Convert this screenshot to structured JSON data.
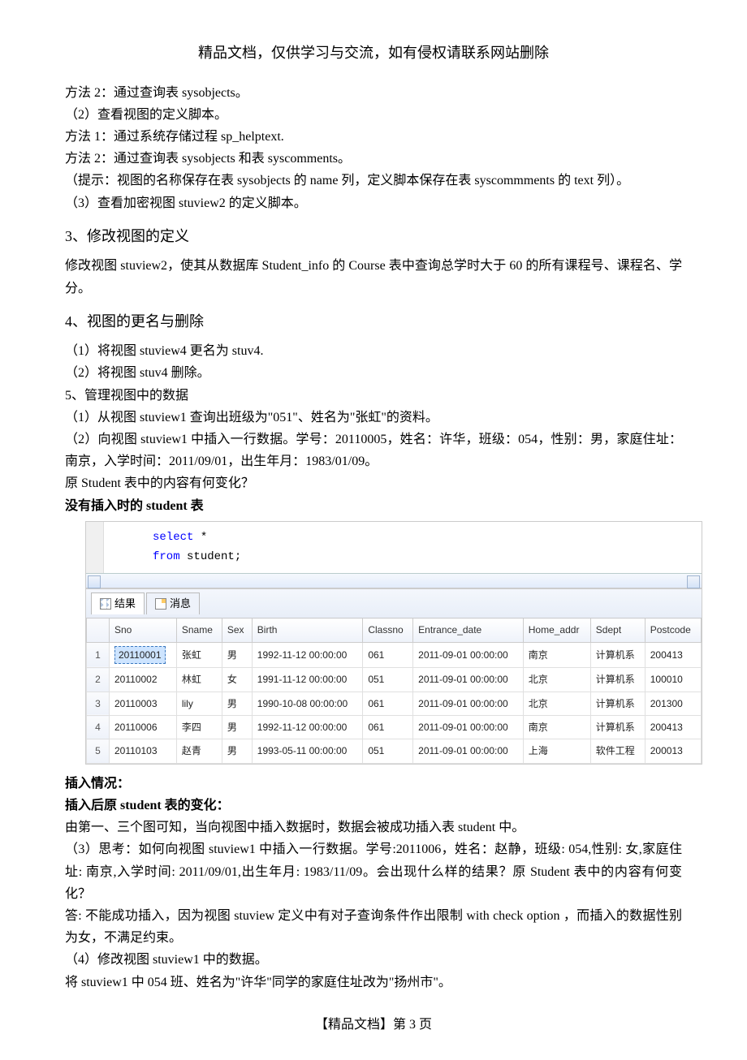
{
  "header": {
    "title": "精品文档，仅供学习与交流，如有侵权请联系网站删除"
  },
  "body": {
    "p1": "方法 2：通过查询表 sysobjects。",
    "p2": "（2）查看视图的定义脚本。",
    "p3": "方法 1：通过系统存储过程 sp_helptext.",
    "p4": "方法 2：通过查询表 sysobjects 和表 syscomments。",
    "p5": "（提示：视图的名称保存在表 sysobjects 的 name 列，定义脚本保存在表 syscommments 的 text 列）。",
    "p6": "（3）查看加密视图 stuview2 的定义脚本。",
    "s3_title": "3、修改视图的定义",
    "p7": "修改视图 stuview2，使其从数据库 Student_info 的 Course 表中查询总学时大于 60 的所有课程号、课程名、学分。",
    "s4_title": "4、视图的更名与删除",
    "p8": "（1）将视图 stuview4 更名为 stuv4.",
    "p9": "（2）将视图 stuv4 删除。",
    "p10": "5、管理视图中的数据",
    "p11": "（1）从视图 stuview1 查询出班级为\"051\"、姓名为\"张虹\"的资料。",
    "p12": "（2）向视图 stuview1 中插入一行数据。学号：20110005，姓名：许华，班级：054，性别：男，家庭住址：南京，入学时间：2011/09/01，出生年月：1983/01/09。",
    "p13": "原 Student 表中的内容有何变化？",
    "p14": "没有插入时的 student 表",
    "p15": "插入情况：",
    "p16": "插入后原 student 表的变化：",
    "p17": "由第一、三个图可知，当向视图中插入数据时，数据会被成功插入表 student 中。",
    "p18": "（3）思考：如何向视图 stuview1 中插入一行数据。学号:2011006，姓名：赵静，班级: 054,性别: 女,家庭住址: 南京,入学时间: 2011/09/01,出生年月: 1983/11/09。会出现什么样的结果？原 Student 表中的内容有何变化？",
    "p19": "答: 不能成功插入，因为视图 stuview 定义中有对子查询条件作出限制 with check option ，而插入的数据性别为女，不满足约束。",
    "p20": "（4）修改视图 stuview1 中的数据。",
    "p21": "将 stuview1 中 054 班、姓名为\"许华\"同学的家庭住址改为\"扬州市\"。"
  },
  "sql": {
    "line1_kw": "select",
    "line1_rest": " *",
    "line2_kw": "from",
    "line2_rest": " student;"
  },
  "tabs": {
    "results": "结果",
    "messages": "消息"
  },
  "chart_data": {
    "type": "table",
    "columns": [
      "",
      "Sno",
      "Sname",
      "Sex",
      "Birth",
      "Classno",
      "Entrance_date",
      "Home_addr",
      "Sdept",
      "Postcode"
    ],
    "rows": [
      [
        "1",
        "20110001",
        "张虹",
        "男",
        "1992-11-12 00:00:00",
        "061",
        "2011-09-01 00:00:00",
        "南京",
        "计算机系",
        "200413"
      ],
      [
        "2",
        "20110002",
        "林虹",
        "女",
        "1991-11-12 00:00:00",
        "051",
        "2011-09-01 00:00:00",
        "北京",
        "计算机系",
        "100010"
      ],
      [
        "3",
        "20110003",
        "lily",
        "男",
        "1990-10-08 00:00:00",
        "061",
        "2011-09-01 00:00:00",
        "北京",
        "计算机系",
        "201300"
      ],
      [
        "4",
        "20110006",
        "李四",
        "男",
        "1992-11-12 00:00:00",
        "061",
        "2011-09-01 00:00:00",
        "南京",
        "计算机系",
        "200413"
      ],
      [
        "5",
        "20110103",
        "赵青",
        "男",
        "1993-05-11 00:00:00",
        "051",
        "2011-09-01 00:00:00",
        "上海",
        "软件工程",
        "200013"
      ]
    ]
  },
  "footer": {
    "text": "【精品文档】第 3 页"
  }
}
